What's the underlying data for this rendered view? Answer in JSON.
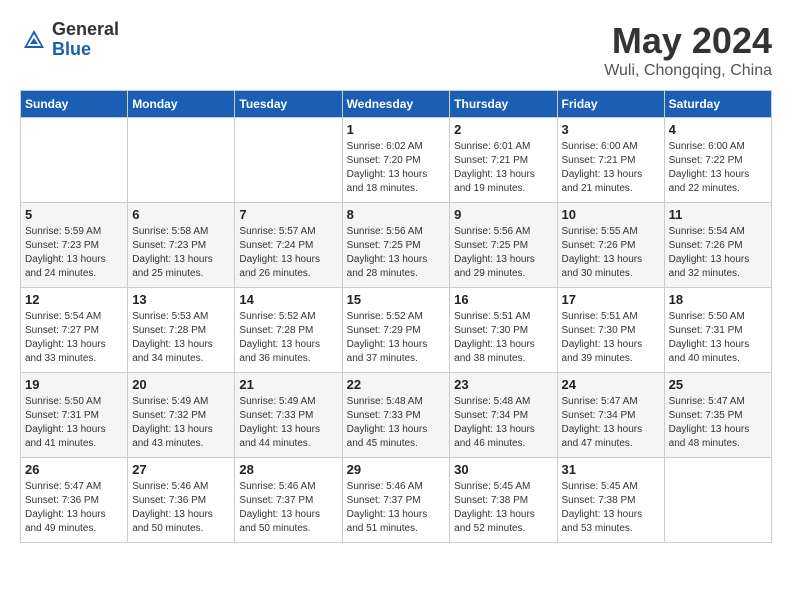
{
  "header": {
    "logo_general": "General",
    "logo_blue": "Blue",
    "month_year": "May 2024",
    "location": "Wuli, Chongqing, China"
  },
  "days_of_week": [
    "Sunday",
    "Monday",
    "Tuesday",
    "Wednesday",
    "Thursday",
    "Friday",
    "Saturday"
  ],
  "weeks": [
    [
      {
        "day": "",
        "sunrise": "",
        "sunset": "",
        "daylight": ""
      },
      {
        "day": "",
        "sunrise": "",
        "sunset": "",
        "daylight": ""
      },
      {
        "day": "",
        "sunrise": "",
        "sunset": "",
        "daylight": ""
      },
      {
        "day": "1",
        "sunrise": "Sunrise: 6:02 AM",
        "sunset": "Sunset: 7:20 PM",
        "daylight": "Daylight: 13 hours and 18 minutes."
      },
      {
        "day": "2",
        "sunrise": "Sunrise: 6:01 AM",
        "sunset": "Sunset: 7:21 PM",
        "daylight": "Daylight: 13 hours and 19 minutes."
      },
      {
        "day": "3",
        "sunrise": "Sunrise: 6:00 AM",
        "sunset": "Sunset: 7:21 PM",
        "daylight": "Daylight: 13 hours and 21 minutes."
      },
      {
        "day": "4",
        "sunrise": "Sunrise: 6:00 AM",
        "sunset": "Sunset: 7:22 PM",
        "daylight": "Daylight: 13 hours and 22 minutes."
      }
    ],
    [
      {
        "day": "5",
        "sunrise": "Sunrise: 5:59 AM",
        "sunset": "Sunset: 7:23 PM",
        "daylight": "Daylight: 13 hours and 24 minutes."
      },
      {
        "day": "6",
        "sunrise": "Sunrise: 5:58 AM",
        "sunset": "Sunset: 7:23 PM",
        "daylight": "Daylight: 13 hours and 25 minutes."
      },
      {
        "day": "7",
        "sunrise": "Sunrise: 5:57 AM",
        "sunset": "Sunset: 7:24 PM",
        "daylight": "Daylight: 13 hours and 26 minutes."
      },
      {
        "day": "8",
        "sunrise": "Sunrise: 5:56 AM",
        "sunset": "Sunset: 7:25 PM",
        "daylight": "Daylight: 13 hours and 28 minutes."
      },
      {
        "day": "9",
        "sunrise": "Sunrise: 5:56 AM",
        "sunset": "Sunset: 7:25 PM",
        "daylight": "Daylight: 13 hours and 29 minutes."
      },
      {
        "day": "10",
        "sunrise": "Sunrise: 5:55 AM",
        "sunset": "Sunset: 7:26 PM",
        "daylight": "Daylight: 13 hours and 30 minutes."
      },
      {
        "day": "11",
        "sunrise": "Sunrise: 5:54 AM",
        "sunset": "Sunset: 7:26 PM",
        "daylight": "Daylight: 13 hours and 32 minutes."
      }
    ],
    [
      {
        "day": "12",
        "sunrise": "Sunrise: 5:54 AM",
        "sunset": "Sunset: 7:27 PM",
        "daylight": "Daylight: 13 hours and 33 minutes."
      },
      {
        "day": "13",
        "sunrise": "Sunrise: 5:53 AM",
        "sunset": "Sunset: 7:28 PM",
        "daylight": "Daylight: 13 hours and 34 minutes."
      },
      {
        "day": "14",
        "sunrise": "Sunrise: 5:52 AM",
        "sunset": "Sunset: 7:28 PM",
        "daylight": "Daylight: 13 hours and 36 minutes."
      },
      {
        "day": "15",
        "sunrise": "Sunrise: 5:52 AM",
        "sunset": "Sunset: 7:29 PM",
        "daylight": "Daylight: 13 hours and 37 minutes."
      },
      {
        "day": "16",
        "sunrise": "Sunrise: 5:51 AM",
        "sunset": "Sunset: 7:30 PM",
        "daylight": "Daylight: 13 hours and 38 minutes."
      },
      {
        "day": "17",
        "sunrise": "Sunrise: 5:51 AM",
        "sunset": "Sunset: 7:30 PM",
        "daylight": "Daylight: 13 hours and 39 minutes."
      },
      {
        "day": "18",
        "sunrise": "Sunrise: 5:50 AM",
        "sunset": "Sunset: 7:31 PM",
        "daylight": "Daylight: 13 hours and 40 minutes."
      }
    ],
    [
      {
        "day": "19",
        "sunrise": "Sunrise: 5:50 AM",
        "sunset": "Sunset: 7:31 PM",
        "daylight": "Daylight: 13 hours and 41 minutes."
      },
      {
        "day": "20",
        "sunrise": "Sunrise: 5:49 AM",
        "sunset": "Sunset: 7:32 PM",
        "daylight": "Daylight: 13 hours and 43 minutes."
      },
      {
        "day": "21",
        "sunrise": "Sunrise: 5:49 AM",
        "sunset": "Sunset: 7:33 PM",
        "daylight": "Daylight: 13 hours and 44 minutes."
      },
      {
        "day": "22",
        "sunrise": "Sunrise: 5:48 AM",
        "sunset": "Sunset: 7:33 PM",
        "daylight": "Daylight: 13 hours and 45 minutes."
      },
      {
        "day": "23",
        "sunrise": "Sunrise: 5:48 AM",
        "sunset": "Sunset: 7:34 PM",
        "daylight": "Daylight: 13 hours and 46 minutes."
      },
      {
        "day": "24",
        "sunrise": "Sunrise: 5:47 AM",
        "sunset": "Sunset: 7:34 PM",
        "daylight": "Daylight: 13 hours and 47 minutes."
      },
      {
        "day": "25",
        "sunrise": "Sunrise: 5:47 AM",
        "sunset": "Sunset: 7:35 PM",
        "daylight": "Daylight: 13 hours and 48 minutes."
      }
    ],
    [
      {
        "day": "26",
        "sunrise": "Sunrise: 5:47 AM",
        "sunset": "Sunset: 7:36 PM",
        "daylight": "Daylight: 13 hours and 49 minutes."
      },
      {
        "day": "27",
        "sunrise": "Sunrise: 5:46 AM",
        "sunset": "Sunset: 7:36 PM",
        "daylight": "Daylight: 13 hours and 50 minutes."
      },
      {
        "day": "28",
        "sunrise": "Sunrise: 5:46 AM",
        "sunset": "Sunset: 7:37 PM",
        "daylight": "Daylight: 13 hours and 50 minutes."
      },
      {
        "day": "29",
        "sunrise": "Sunrise: 5:46 AM",
        "sunset": "Sunset: 7:37 PM",
        "daylight": "Daylight: 13 hours and 51 minutes."
      },
      {
        "day": "30",
        "sunrise": "Sunrise: 5:45 AM",
        "sunset": "Sunset: 7:38 PM",
        "daylight": "Daylight: 13 hours and 52 minutes."
      },
      {
        "day": "31",
        "sunrise": "Sunrise: 5:45 AM",
        "sunset": "Sunset: 7:38 PM",
        "daylight": "Daylight: 13 hours and 53 minutes."
      },
      {
        "day": "",
        "sunrise": "",
        "sunset": "",
        "daylight": ""
      }
    ]
  ]
}
